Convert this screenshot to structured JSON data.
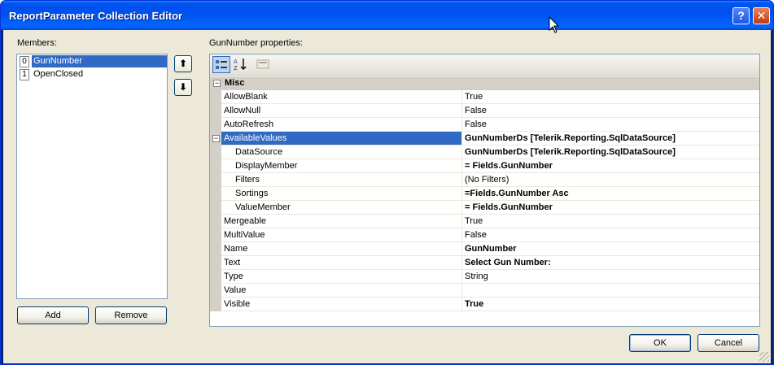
{
  "window": {
    "title": "ReportParameter Collection Editor",
    "help_glyph": "?",
    "close_glyph": "✕"
  },
  "members": {
    "label": "Members:",
    "items": [
      {
        "index": "0",
        "name": "GunNumber",
        "selected": true
      },
      {
        "index": "1",
        "name": "OpenClosed",
        "selected": false
      }
    ],
    "move_up_glyph": "⬆",
    "move_down_glyph": "⬇",
    "add_label": "Add",
    "remove_label": "Remove"
  },
  "properties": {
    "label": "GunNumber properties:",
    "category": "Misc",
    "category_toggle": "⊟",
    "rows": [
      {
        "name": "AllowBlank",
        "value": "True",
        "bold": false
      },
      {
        "name": "AllowNull",
        "value": "False",
        "bold": false
      },
      {
        "name": "AutoRefresh",
        "value": "False",
        "bold": false
      },
      {
        "name": "AvailableValues",
        "value": "GunNumberDs [Telerik.Reporting.SqlDataSource]",
        "bold": true,
        "selected": true,
        "expandable": true
      },
      {
        "name": "DataSource",
        "value": "GunNumberDs [Telerik.Reporting.SqlDataSource]",
        "bold": true,
        "sub": true
      },
      {
        "name": "DisplayMember",
        "value": "= Fields.GunNumber",
        "bold": true,
        "sub": true
      },
      {
        "name": "Filters",
        "value": "(No Filters)",
        "bold": false,
        "sub": true
      },
      {
        "name": "Sortings",
        "value": "=Fields.GunNumber Asc",
        "bold": true,
        "sub": true
      },
      {
        "name": "ValueMember",
        "value": "= Fields.GunNumber",
        "bold": true,
        "sub": true
      },
      {
        "name": "Mergeable",
        "value": "True",
        "bold": false
      },
      {
        "name": "MultiValue",
        "value": "False",
        "bold": false
      },
      {
        "name": "Name",
        "value": "GunNumber",
        "bold": true
      },
      {
        "name": "Text",
        "value": "Select Gun Number:",
        "bold": true
      },
      {
        "name": "Type",
        "value": "String",
        "bold": false
      },
      {
        "name": "Value",
        "value": "",
        "bold": false
      },
      {
        "name": "Visible",
        "value": "True",
        "bold": true
      }
    ]
  },
  "toolbar": {
    "categorized_icon": "categorized-icon",
    "alphabetical_icon": "alphabetical-icon",
    "property_pages_icon": "property-pages-icon"
  },
  "footer": {
    "ok_label": "OK",
    "cancel_label": "Cancel"
  }
}
